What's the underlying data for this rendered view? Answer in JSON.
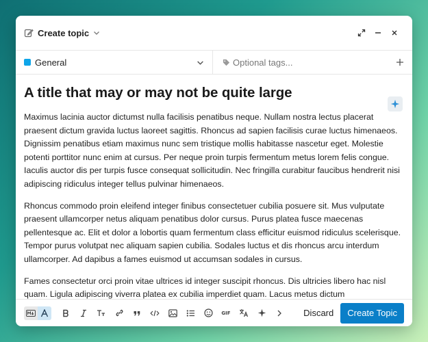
{
  "header": {
    "action_label": "Create topic"
  },
  "fields": {
    "category_name": "General",
    "category_color": "#0ea5e9",
    "tags_placeholder": "Optional tags..."
  },
  "editor": {
    "title": "A title that may or may not be quite large",
    "paragraphs": [
      "Maximus lacinia auctor dictumst nulla facilisis penatibus neque. Nullam nostra lectus placerat praesent dictum gravida luctus laoreet sagittis. Rhoncus ad sapien facilisis curae luctus himenaeos. Dignissim penatibus etiam maximus nunc sem tristique mollis habitasse nascetur eget. Molestie potenti porttitor nunc enim at cursus. Per neque proin turpis fermentum metus lorem felis congue. Iaculis auctor dis per turpis fusce consequat sollicitudin. Nec fringilla curabitur faucibus hendrerit nisi adipiscing ridiculus integer tellus pulvinar himenaeos.",
      "Rhoncus commodo proin eleifend integer finibus consectetuer cubilia posuere sit. Mus vulputate praesent ullamcorper netus aliquam penatibus dolor cursus. Purus platea fusce maecenas pellentesque ac. Elit et dolor a lobortis quam fermentum class efficitur euismod ridiculus scelerisque. Tempor purus volutpat nec aliquam sapien cubilia. Sodales luctus et dis rhoncus arcu interdum ullamcorper. Ad dapibus a fames euismod ut accumsan sodales in cursus.",
      "Fames consectetur orci proin vitae ultrices id integer suscipit rhoncus. Dis ultricies libero hac nisl quam. Ligula adipiscing viverra platea ex cubilia imperdiet quam. Lacus metus dictum"
    ]
  },
  "toolbar": {
    "discard_label": "Discard",
    "create_label": "Create Topic",
    "gif_label": "GIF",
    "primary_color": "#0a7fc8"
  }
}
